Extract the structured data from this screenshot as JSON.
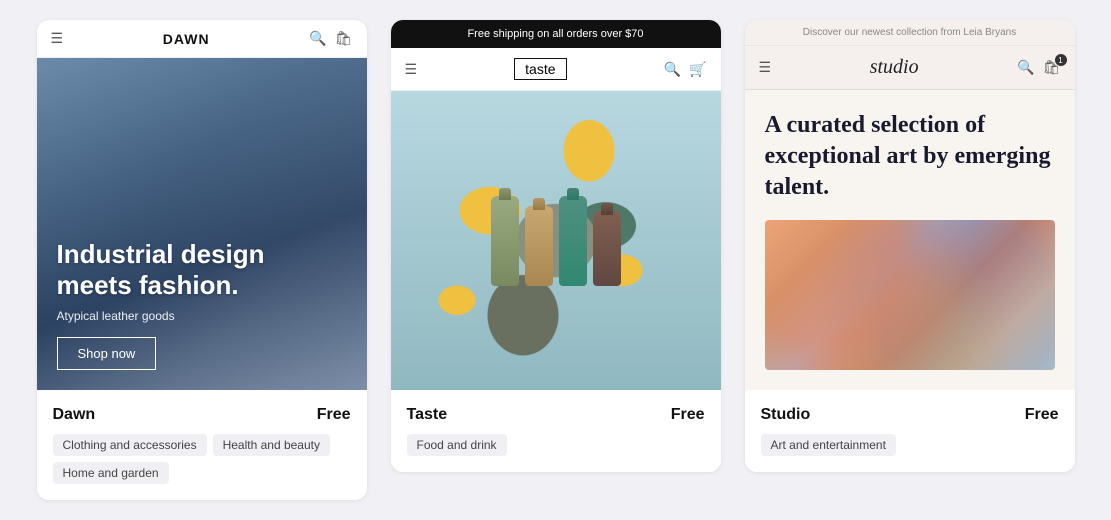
{
  "cards": [
    {
      "id": "dawn",
      "name": "Dawn",
      "price": "Free",
      "tags": [
        "Clothing and accessories",
        "Health and beauty",
        "Home and garden"
      ],
      "preview": {
        "type": "dawn",
        "nav_title": "DAWN",
        "banner": null,
        "hero_title": "Industrial design meets fashion.",
        "hero_sub": "Atypical leather goods",
        "hero_cta": "Shop now"
      }
    },
    {
      "id": "taste",
      "name": "Taste",
      "price": "Free",
      "tags": [
        "Food and drink"
      ],
      "preview": {
        "type": "taste",
        "nav_title": "taste",
        "banner": "Free shipping on all orders over $70",
        "hero_title": null,
        "hero_sub": null,
        "hero_cta": null
      }
    },
    {
      "id": "studio",
      "name": "Studio",
      "price": "Free",
      "tags": [
        "Art and entertainment"
      ],
      "preview": {
        "type": "studio",
        "nav_title": "studio",
        "top_banner": "Discover our newest collection from Leia Bryans",
        "hero_title": "A curated selection of exceptional art by emerging talent.",
        "hero_sub": null,
        "hero_cta": null
      }
    }
  ]
}
